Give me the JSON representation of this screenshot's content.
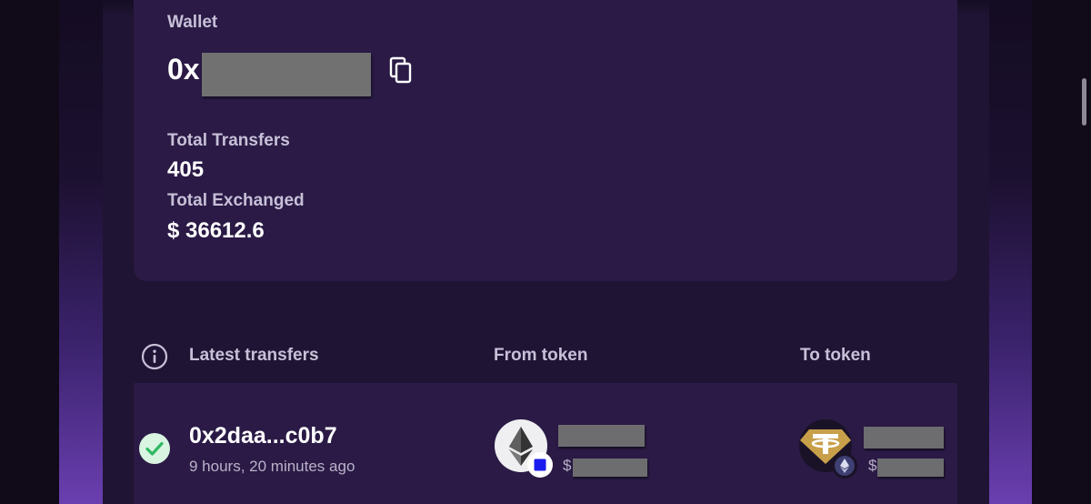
{
  "wallet": {
    "label": "Wallet",
    "address_prefix": "0x",
    "copy_icon": "copy-icon"
  },
  "stats": {
    "total_transfers_label": "Total Transfers",
    "total_transfers_value": "405",
    "total_exchanged_label": "Total Exchanged",
    "total_exchanged_value": "$ 36612.6"
  },
  "table": {
    "info_icon": "info-icon",
    "headers": [
      "Latest transfers",
      "From token",
      "To token"
    ]
  },
  "transfers": [
    {
      "status_icon": "check-circle-icon",
      "hash": "0x2daa...c0b7",
      "time": "9 hours, 20 minutes ago",
      "from_token_icon": "ethereum-icon",
      "from_chain_badge": "blue-square-icon",
      "from_usd_prefix": "$",
      "to_token_icon": "tether-icon",
      "to_chain_badge": "ethereum-icon",
      "to_usd_prefix": "$"
    }
  ],
  "colors": {
    "background": "#1f1433",
    "card": "#2a1a45",
    "text_primary": "#ffffff",
    "text_secondary": "#c7c0d8",
    "success": "#34c46a",
    "accent_glow": "#6a3fb0"
  }
}
